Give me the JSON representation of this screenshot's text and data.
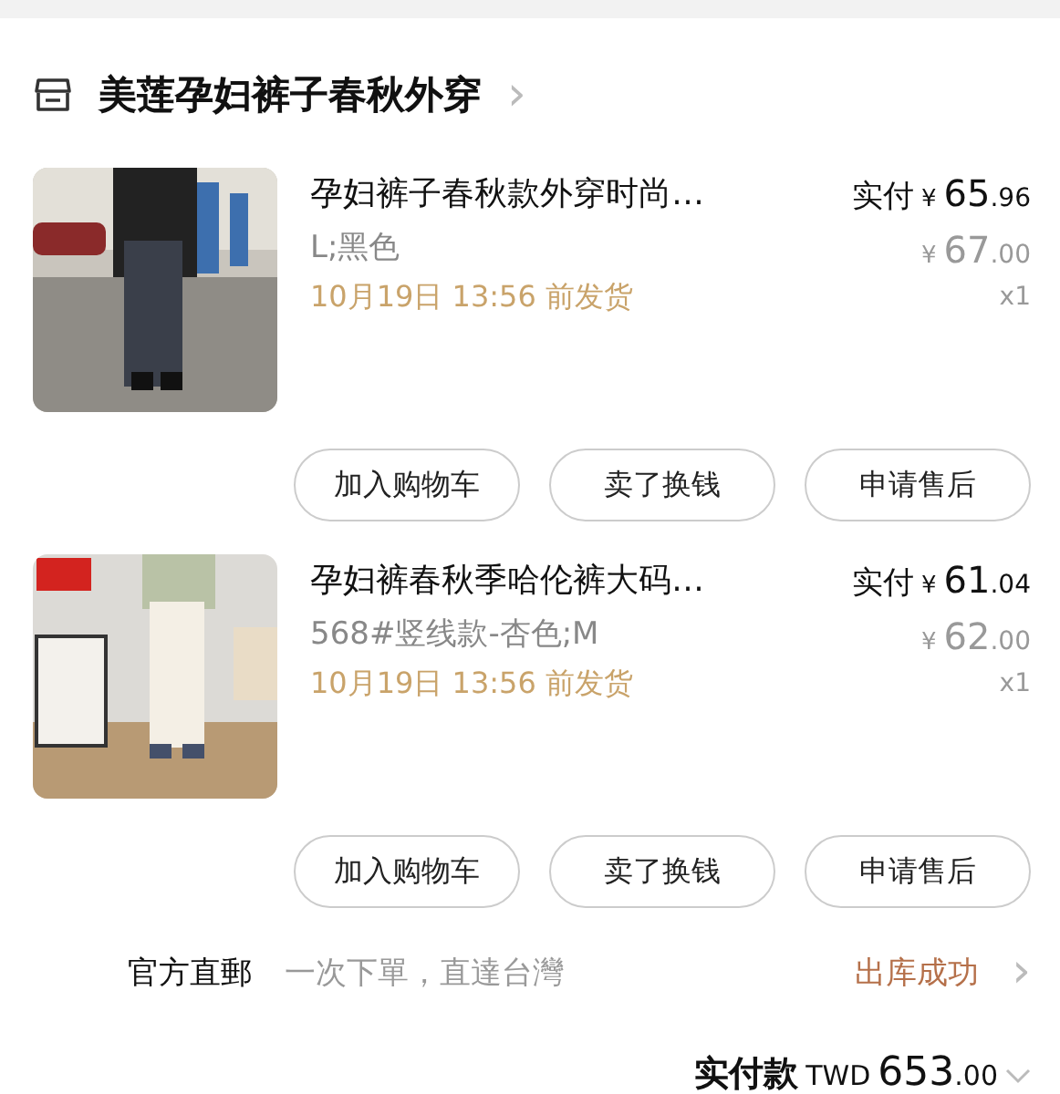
{
  "shop": {
    "name": "美莲孕妇裤子春秋外穿",
    "chevron": "›"
  },
  "items": [
    {
      "title": "孕妇裤子春秋款外穿时尚…",
      "variant": "L;黑色",
      "ship_note": "10月19日 13:56 前发货",
      "paid_label": "实付",
      "paid_currency": "¥",
      "paid_whole": "65",
      "paid_fraction": ".96",
      "orig_currency": "¥",
      "orig_whole": "67",
      "orig_fraction": ".00",
      "quantity": "x1",
      "actions": [
        "加入购物车",
        "卖了换钱",
        "申请售后"
      ]
    },
    {
      "title": "孕妇裤春秋季哈伦裤大码…",
      "variant": "568#竖线款-杏色;M",
      "ship_note": "10月19日 13:56 前发货",
      "paid_label": "实付",
      "paid_currency": "¥",
      "paid_whole": "61",
      "paid_fraction": ".04",
      "orig_currency": "¥",
      "orig_whole": "62",
      "orig_fraction": ".00",
      "quantity": "x1",
      "actions": [
        "加入购物车",
        "卖了换钱",
        "申请售后"
      ]
    }
  ],
  "shipping": {
    "label": "官方直郵",
    "note": "一次下單，直達台灣",
    "status": "出库成功",
    "chevron": "›"
  },
  "total": {
    "label": "实付款",
    "currency": "TWD",
    "whole": "653",
    "fraction": ".00"
  }
}
